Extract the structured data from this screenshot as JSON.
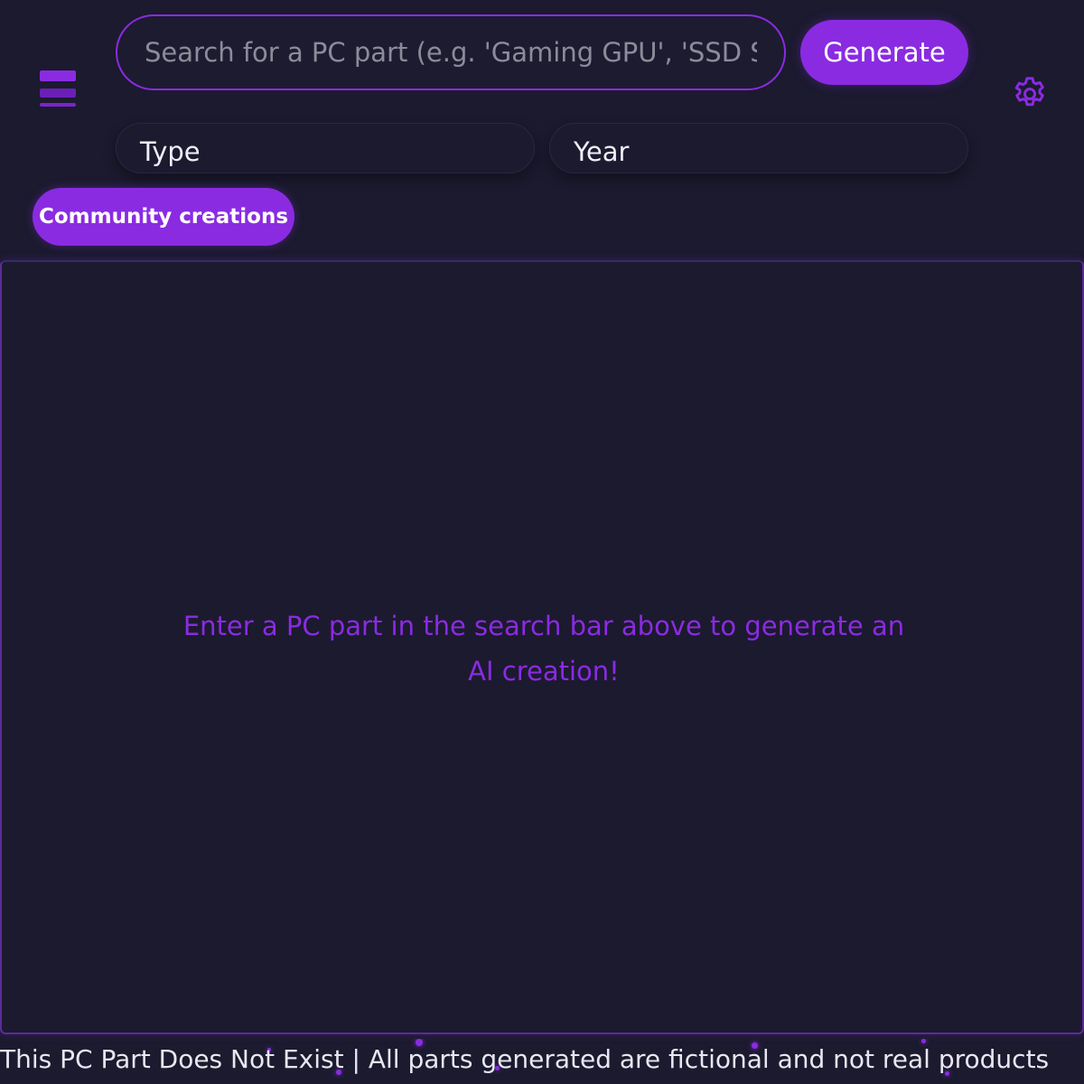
{
  "header": {
    "menu_icon": "hamburger-menu-icon",
    "search": {
      "placeholder": "Search for a PC part (e.g. 'Gaming GPU', 'SSD Storage')",
      "value": ""
    },
    "generate_label": "Generate",
    "settings_icon": "gear-icon"
  },
  "filters": {
    "type_label": "Type",
    "year_label": "Year"
  },
  "community_label": "Community creations",
  "main": {
    "hint_line1": "Enter a PC part in the search bar above to generate an",
    "hint_line2": "AI creation!"
  },
  "footer": {
    "text": "This PC Part Does Not Exist | All parts generated are fictional and not real products"
  },
  "colors": {
    "background": "#1b1a2e",
    "accent": "#8a2be2",
    "text": "#e8e6f0"
  }
}
